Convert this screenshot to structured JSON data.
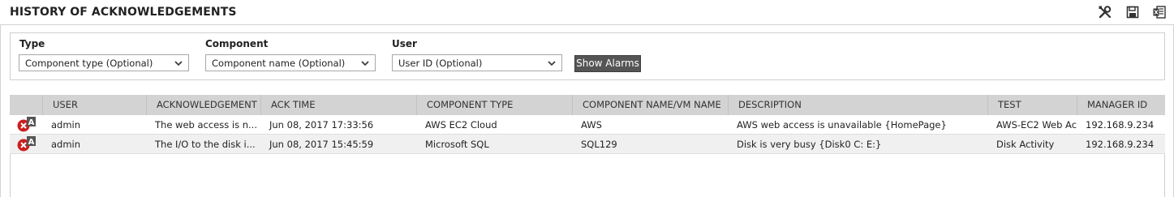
{
  "window": {
    "title": "HISTORY OF ACKNOWLEDGEMENTS",
    "toolbar": [
      {
        "icon": "tools-icon"
      },
      {
        "icon": "save-icon"
      },
      {
        "icon": "excel-export-icon"
      }
    ]
  },
  "filters": {
    "type": {
      "label": "Type",
      "value": "Component type (Optional)"
    },
    "component": {
      "label": "Component",
      "value": "Component name (Optional)"
    },
    "user": {
      "label": "User",
      "value": "User ID (Optional)"
    },
    "show_button": "Show Alarms"
  },
  "table": {
    "columns": [
      "USER",
      "ACKNOWLEDGEMENT",
      "ACK TIME",
      "COMPONENT TYPE",
      "COMPONENT NAME/VM NAME",
      "DESCRIPTION",
      "TEST",
      "MANAGER ID"
    ],
    "rows": [
      {
        "status_badge": "A",
        "user": "admin",
        "acknowledgement": "The web access is n...",
        "ack_time": "Jun 08, 2017 17:33:56",
        "component_type": "AWS EC2 Cloud",
        "component_name": "AWS",
        "description": "AWS web access is unavailable {HomePage}",
        "test": "AWS-EC2 Web Ac...",
        "manager_id": "192.168.9.234"
      },
      {
        "status_badge": "A",
        "user": "admin",
        "acknowledgement": "The I/O to the disk i...",
        "ack_time": "Jun 08, 2017 15:45:59",
        "component_type": "Microsoft SQL",
        "component_name": "SQL129",
        "description": "Disk is very busy {Disk0 C: E:}",
        "test": "Disk Activity",
        "manager_id": "192.168.9.234"
      }
    ]
  },
  "colors": {
    "header_bg": "#d3d3d3",
    "button_bg": "#555555",
    "alarm_red": "#cc1f1f",
    "badge_bg": "#555555"
  }
}
